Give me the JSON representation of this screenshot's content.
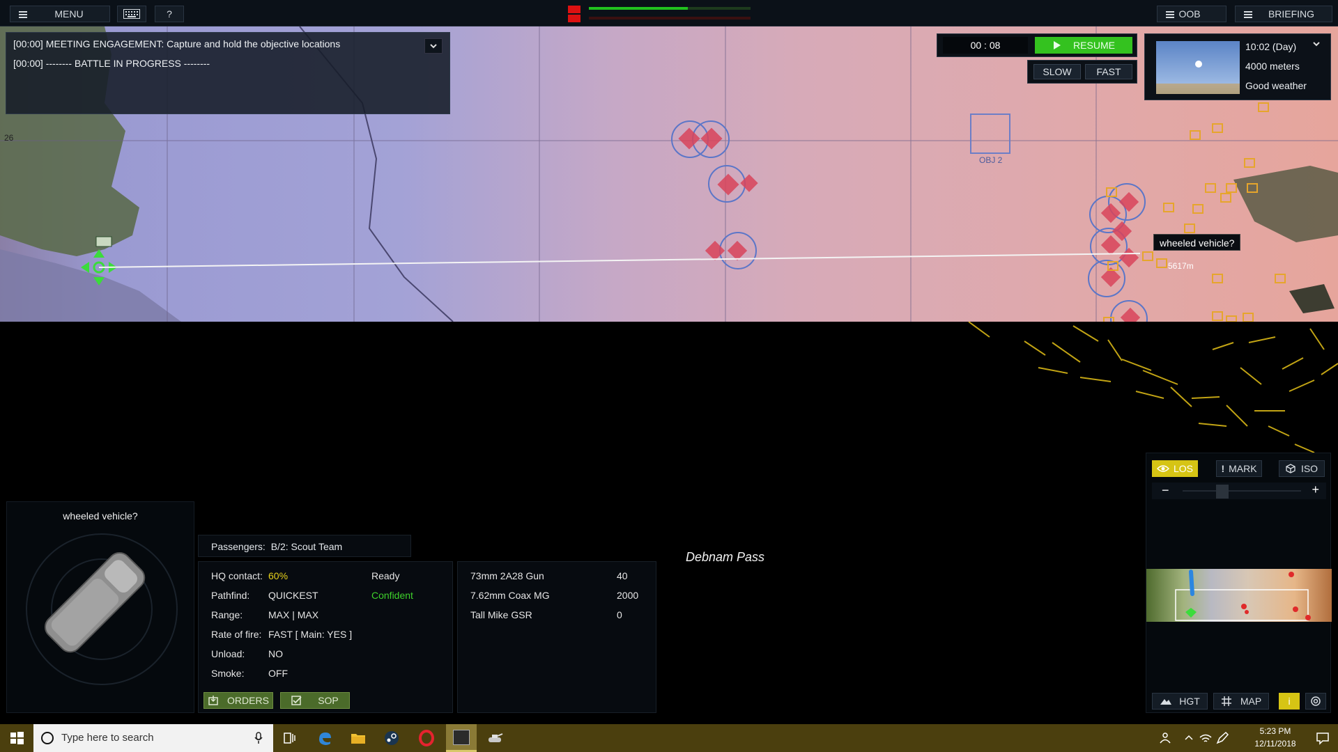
{
  "topbar": {
    "menu_label": "MENU",
    "help_label": "?",
    "oob_label": "OOB",
    "briefing_label": "BRIEFING",
    "health": {
      "flag_color": "#dd1111",
      "bar1_fraction": 0.61,
      "bar1_color": "#21c21e",
      "bar2_fraction": 0.0,
      "bar2_color": "#6a1414"
    }
  },
  "messages": [
    "[00:00] MEETING ENGAGEMENT: Capture and hold the objective locations",
    "[00:00] -------- BATTLE IN PROGRESS --------"
  ],
  "time": {
    "clock": "00 : 08",
    "resume_label": "RESUME",
    "slow_label": "SLOW",
    "fast_label": "FAST"
  },
  "weather": {
    "time_of_day": "10:02 (Day)",
    "visibility": "4000 meters",
    "condition": "Good weather"
  },
  "map": {
    "grid_label": "26",
    "objective_label": "OBJ 2",
    "tooltip": "wheeled vehicle?",
    "range_label": "5617m"
  },
  "unit": {
    "name": "wheeled vehicle?",
    "passengers_label": "Passengers:",
    "passengers_value": "B/2: Scout Team",
    "status": [
      {
        "label": "HQ contact:",
        "value": "60%",
        "color": "#e8d21b"
      },
      {
        "label": "Pathfind:",
        "value": "QUICKEST",
        "color": "#e6e6e6"
      },
      {
        "label": "Range:",
        "value": "MAX | MAX",
        "color": "#e6e6e6"
      },
      {
        "label": "Rate of fire:",
        "value": "FAST [ Main: YES ]",
        "color": "#e6e6e6"
      },
      {
        "label": "Unload:",
        "value": "NO",
        "color": "#e6e6e6"
      },
      {
        "label": "Smoke:",
        "value": "OFF",
        "color": "#e6e6e6"
      }
    ],
    "readiness": "Ready",
    "morale": "Confident",
    "morale_color": "#3ed12b",
    "weapons": [
      {
        "name": "73mm 2A28 Gun",
        "ammo": "40"
      },
      {
        "name": "7.62mm Coax MG",
        "ammo": "2000"
      },
      {
        "name": "Tall Mike GSR",
        "ammo": "0"
      }
    ],
    "orders_label": "ORDERS",
    "sop_label": "SOP"
  },
  "location_name": "Debnam Pass",
  "tools": {
    "los_label": "LOS",
    "mark_label": "MARK",
    "iso_label": "ISO",
    "zoom_minus": "−",
    "zoom_plus": "+",
    "hgt_label": "HGT",
    "map_label": "MAP",
    "info_label": "i",
    "active_color": "#d6c414"
  },
  "taskbar": {
    "search_placeholder": "Type here to search",
    "time": "5:23 PM",
    "date": "12/11/2018"
  }
}
